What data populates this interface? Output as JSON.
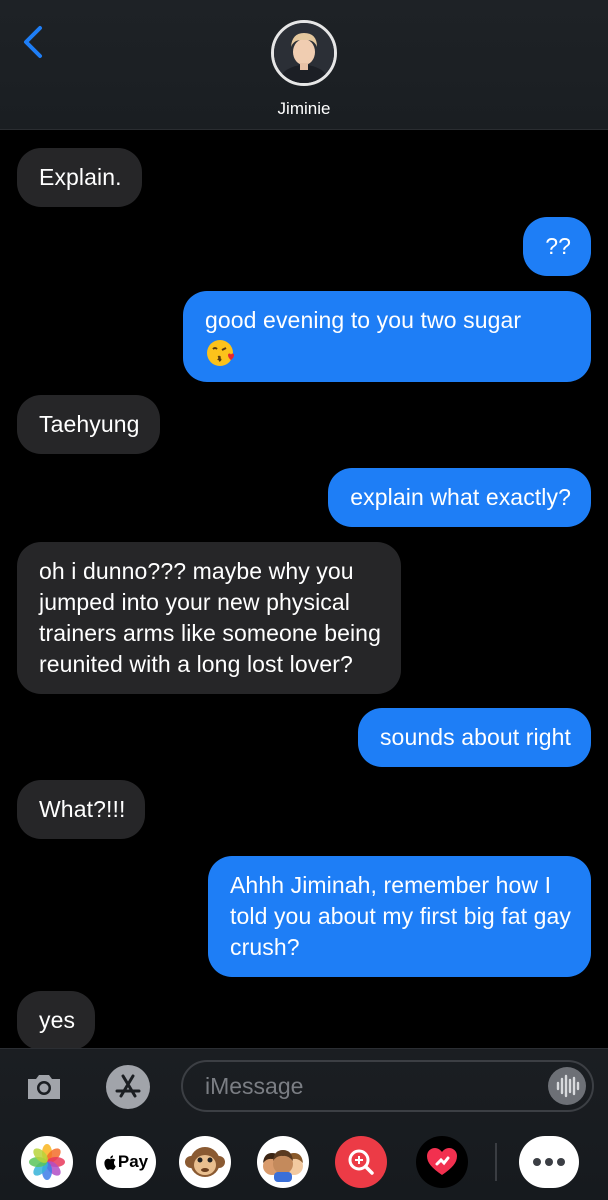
{
  "header": {
    "contact_name": "Jiminie",
    "back_icon": "chevron-left-icon",
    "accent_color": "#1e7ef6"
  },
  "messages": [
    {
      "direction": "received",
      "text": "Explain."
    },
    {
      "direction": "sent",
      "text": "??"
    },
    {
      "direction": "sent",
      "text": "good evening to you two sugar",
      "emoji": "kissing-face-heart-emoji"
    },
    {
      "direction": "received",
      "text": "Taehyung"
    },
    {
      "direction": "sent",
      "text": "explain what exactly?"
    },
    {
      "direction": "received",
      "lines": [
        "oh i dunno??? maybe why you",
        "jumped into your new physical",
        "trainers arms like someone being",
        "reunited with a long lost lover?"
      ]
    },
    {
      "direction": "sent",
      "text": "sounds about right"
    },
    {
      "direction": "received",
      "text": "What?!!!"
    },
    {
      "direction": "sent",
      "lines": [
        "Ahhh Jiminah, remember how I",
        "told you about my first big fat gay",
        "crush?"
      ]
    },
    {
      "direction": "received",
      "text": "yes"
    }
  ],
  "input": {
    "placeholder": "iMessage",
    "camera_icon": "camera-icon",
    "apps_icon": "app-store-icon",
    "audio_icon": "waveform-icon"
  },
  "app_strip": {
    "items": [
      {
        "name": "photos-app-icon"
      },
      {
        "name": "apple-pay-icon",
        "label": "Pay"
      },
      {
        "name": "monkey-animoji-icon"
      },
      {
        "name": "memoji-icon"
      },
      {
        "name": "image-search-icon"
      },
      {
        "name": "digital-touch-icon"
      },
      {
        "name": "more-apps-icon"
      }
    ]
  },
  "colors": {
    "sent_bubble": "#1e7ef6",
    "received_bubble": "#262628",
    "background": "#000000"
  }
}
